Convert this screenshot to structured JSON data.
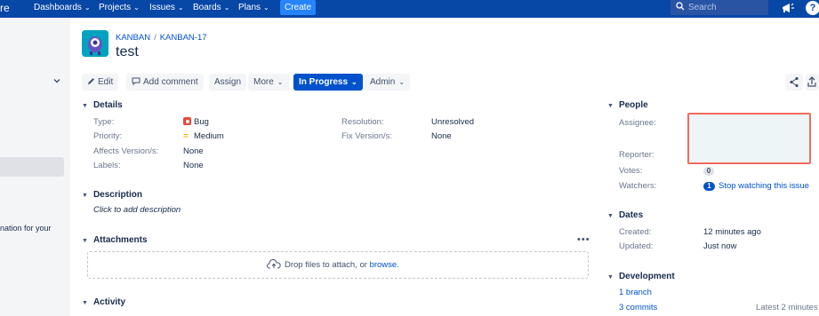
{
  "nav": {
    "brand": "re",
    "items": [
      {
        "label": "Dashboards"
      },
      {
        "label": "Projects"
      },
      {
        "label": "Issues"
      },
      {
        "label": "Boards"
      },
      {
        "label": "Plans"
      }
    ],
    "create_label": "Create",
    "search_placeholder": "Search",
    "help_label": "?"
  },
  "sidebar": {
    "info_text": "nation for your"
  },
  "header": {
    "project": "KANBAN",
    "issue_key": "KANBAN-17",
    "title": "test"
  },
  "toolbar": {
    "edit": "Edit",
    "add_comment": "Add comment",
    "assign": "Assign",
    "more": "More",
    "status": "In Progress",
    "admin": "Admin"
  },
  "details": {
    "heading": "Details",
    "type_label": "Type:",
    "type_value": "Bug",
    "priority_label": "Priority:",
    "priority_value": "Medium",
    "affects_label": "Affects Version/s:",
    "affects_value": "None",
    "labels_label": "Labels:",
    "labels_value": "None",
    "resolution_label": "Resolution:",
    "resolution_value": "Unresolved",
    "fix_label": "Fix Version/s:",
    "fix_value": "None"
  },
  "description": {
    "heading": "Description",
    "hint": "Click to add description"
  },
  "attachments": {
    "heading": "Attachments",
    "drop_text": "Drop files to attach, or ",
    "browse": "browse."
  },
  "activity": {
    "heading": "Activity"
  },
  "people": {
    "heading": "People",
    "assignee_label": "Assignee:",
    "reporter_label": "Reporter:",
    "votes_label": "Votes:",
    "votes_value": "0",
    "watchers_label": "Watchers:",
    "watchers_count": "1",
    "watchers_action": "Stop watching this issue"
  },
  "dates": {
    "heading": "Dates",
    "created_label": "Created:",
    "created_value": "12 minutes ago",
    "updated_label": "Updated:",
    "updated_value": "Just now"
  },
  "development": {
    "heading": "Development",
    "branches": "1 branch",
    "commits": "3 commits",
    "latest": "Latest 2 minutes"
  },
  "colors": {
    "nav_bg": "#0747a6",
    "primary": "#0052cc",
    "highlight_border": "#f2695d"
  }
}
